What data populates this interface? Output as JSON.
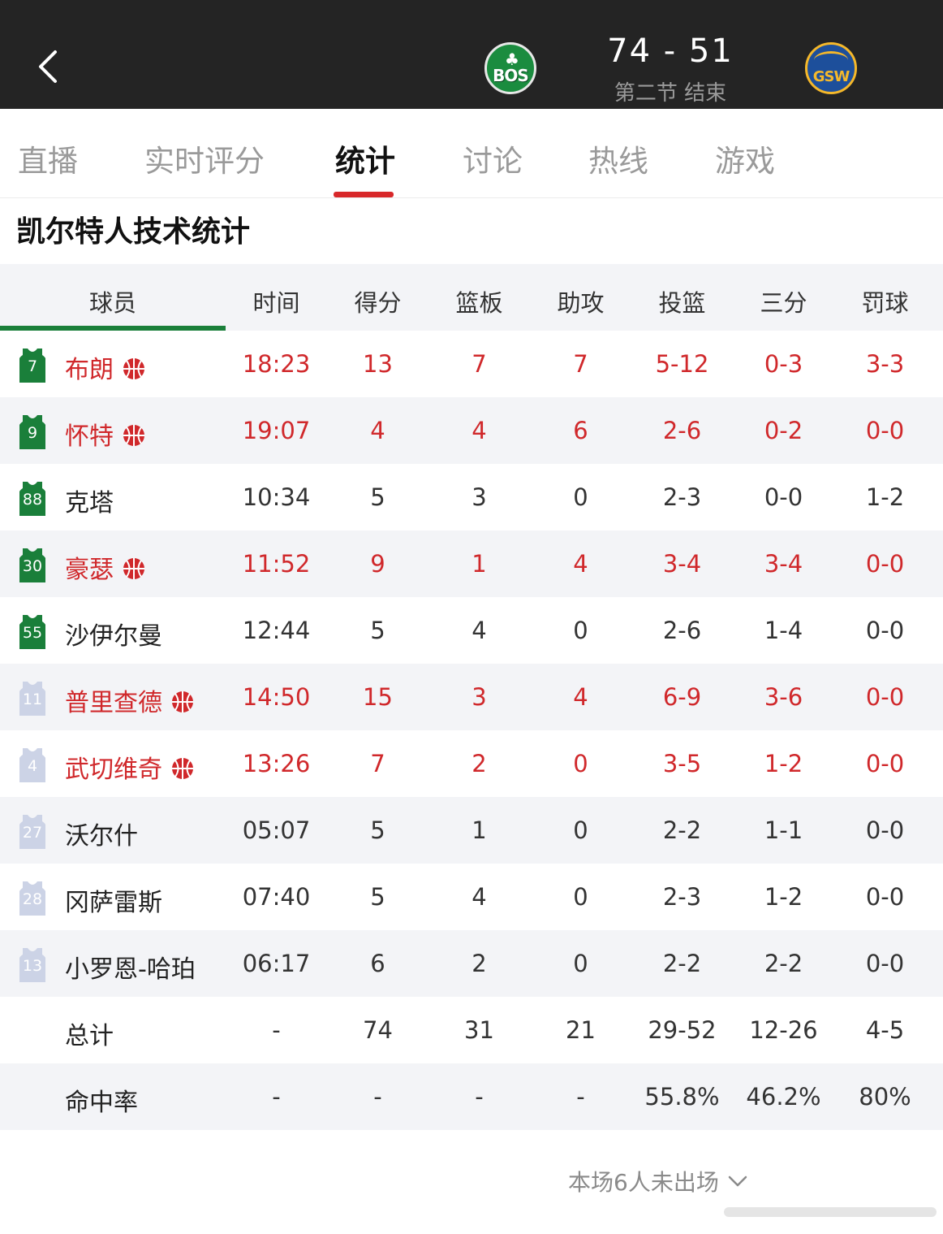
{
  "header": {
    "back_icon": "chevron-left-icon",
    "home_team": "BOS",
    "away_team": "GSW",
    "score": "74 - 51",
    "period": "第二节 结束",
    "bg_color": "#242424"
  },
  "tabs": [
    {
      "label": "直播",
      "active": false
    },
    {
      "label": "实时评分",
      "active": false
    },
    {
      "label": "统计",
      "active": true
    },
    {
      "label": "讨论",
      "active": false
    },
    {
      "label": "热线",
      "active": false
    },
    {
      "label": "游戏",
      "active": false
    }
  ],
  "section_title": "凯尔特人技术统计",
  "table": {
    "headers": [
      "球员",
      "时间",
      "得分",
      "篮板",
      "助攻",
      "投篮",
      "三分",
      "罚球"
    ],
    "players": [
      {
        "number": "7",
        "name": "布朗",
        "starter": true,
        "time": "18:23",
        "pts": "13",
        "reb": "7",
        "ast": "7",
        "fg": "5-12",
        "three": "0-3",
        "ft": "3-3"
      },
      {
        "number": "9",
        "name": "怀特",
        "starter": true,
        "time": "19:07",
        "pts": "4",
        "reb": "4",
        "ast": "6",
        "fg": "2-6",
        "three": "0-2",
        "ft": "0-0"
      },
      {
        "number": "88",
        "name": "克塔",
        "starter": false,
        "time": "10:34",
        "pts": "5",
        "reb": "3",
        "ast": "0",
        "fg": "2-3",
        "three": "0-0",
        "ft": "1-2"
      },
      {
        "number": "30",
        "name": "豪瑟",
        "starter": true,
        "time": "11:52",
        "pts": "9",
        "reb": "1",
        "ast": "4",
        "fg": "3-4",
        "three": "3-4",
        "ft": "0-0"
      },
      {
        "number": "55",
        "name": "沙伊尔曼",
        "starter": false,
        "time": "12:44",
        "pts": "5",
        "reb": "4",
        "ast": "0",
        "fg": "2-6",
        "three": "1-4",
        "ft": "0-0"
      },
      {
        "number": "11",
        "name": "普里查德",
        "starter": true,
        "time": "14:50",
        "pts": "15",
        "reb": "3",
        "ast": "4",
        "fg": "6-9",
        "three": "3-6",
        "ft": "0-0"
      },
      {
        "number": "4",
        "name": "武切维奇",
        "starter": true,
        "time": "13:26",
        "pts": "7",
        "reb": "2",
        "ast": "0",
        "fg": "3-5",
        "three": "1-2",
        "ft": "0-0"
      },
      {
        "number": "27",
        "name": "沃尔什",
        "starter": false,
        "time": "05:07",
        "pts": "5",
        "reb": "1",
        "ast": "0",
        "fg": "2-2",
        "three": "1-1",
        "ft": "0-0"
      },
      {
        "number": "28",
        "name": "冈萨雷斯",
        "starter": false,
        "time": "07:40",
        "pts": "5",
        "reb": "4",
        "ast": "0",
        "fg": "2-3",
        "three": "1-2",
        "ft": "0-0"
      },
      {
        "number": "13",
        "name": "小罗恩-哈珀",
        "starter": false,
        "time": "06:17",
        "pts": "6",
        "reb": "2",
        "ast": "0",
        "fg": "2-2",
        "three": "2-2",
        "ft": "0-0"
      }
    ],
    "total": {
      "label": "总计",
      "time": "-",
      "pts": "74",
      "reb": "31",
      "ast": "21",
      "fg": "29-52",
      "three": "12-26",
      "ft": "4-5"
    },
    "pct": {
      "label": "命中率",
      "time": "-",
      "pts": "-",
      "reb": "-",
      "ast": "-",
      "fg": "55.8%",
      "three": "46.2%",
      "ft": "80%"
    }
  },
  "footer": {
    "dnp_label": "本场6人未出场",
    "dnp_icon": "chevron-down-icon"
  },
  "colors": {
    "accent_red": "#d0282b",
    "team_green": "#1a7f3a",
    "bench_jersey": "#ccd3e6"
  }
}
